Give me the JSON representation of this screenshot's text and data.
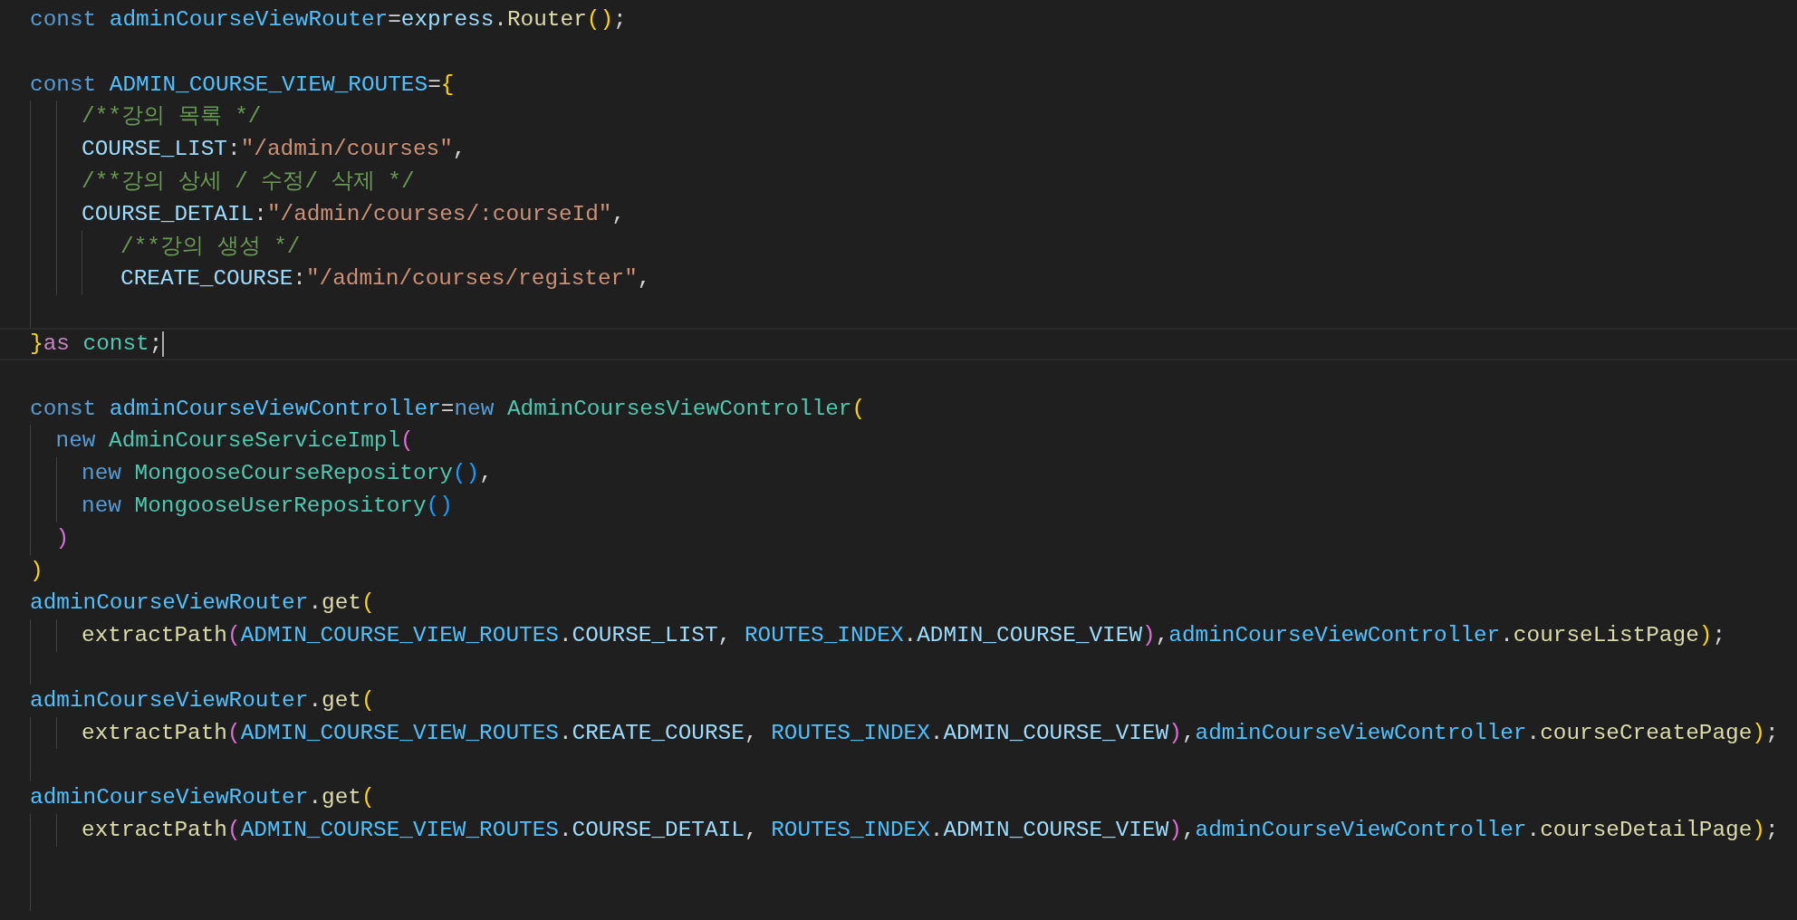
{
  "editor": {
    "lines": [
      {
        "kind": "code",
        "tokens": [
          {
            "kind": "kw",
            "text": "const "
          },
          {
            "kind": "var",
            "text": "adminCourseViewRouter"
          },
          {
            "kind": "plain",
            "text": "="
          },
          {
            "kind": "prop",
            "text": "express"
          },
          {
            "kind": "plain",
            "text": "."
          },
          {
            "kind": "fn",
            "text": "Router"
          },
          {
            "kind": "b1",
            "text": "()"
          },
          {
            "kind": "plain",
            "text": ";"
          }
        ]
      },
      {
        "kind": "blank"
      },
      {
        "kind": "code",
        "tokens": [
          {
            "kind": "kw",
            "text": "const "
          },
          {
            "kind": "var",
            "text": "ADMIN_COURSE_VIEW_ROUTES"
          },
          {
            "kind": "plain",
            "text": "="
          },
          {
            "kind": "b1",
            "text": "{"
          }
        ]
      },
      {
        "kind": "code",
        "indent": [
          {
            "kind": "guide"
          },
          {
            "kind": "guide"
          }
        ],
        "tokens": [
          {
            "kind": "comment",
            "text": "/**강의 목록 */"
          }
        ]
      },
      {
        "kind": "code",
        "indent": [
          {
            "kind": "guide"
          },
          {
            "kind": "guide"
          }
        ],
        "tokens": [
          {
            "kind": "prop",
            "text": "COURSE_LIST"
          },
          {
            "kind": "plain",
            "text": ":"
          },
          {
            "kind": "str",
            "text": "\"/admin/courses\""
          },
          {
            "kind": "plain",
            "text": ","
          }
        ]
      },
      {
        "kind": "code",
        "indent": [
          {
            "kind": "guide"
          },
          {
            "kind": "guide"
          }
        ],
        "tokens": [
          {
            "kind": "comment",
            "text": "/**강의 상세 / 수정/ 삭제 */"
          }
        ]
      },
      {
        "kind": "code",
        "indent": [
          {
            "kind": "guide"
          },
          {
            "kind": "guide"
          }
        ],
        "tokens": [
          {
            "kind": "prop",
            "text": "COURSE_DETAIL"
          },
          {
            "kind": "plain",
            "text": ":"
          },
          {
            "kind": "str",
            "text": "\"/admin/courses/:courseId\""
          },
          {
            "kind": "plain",
            "text": ","
          }
        ]
      },
      {
        "kind": "code",
        "indent": [
          {
            "kind": "guide"
          },
          {
            "kind": "guide"
          },
          {
            "kind": "wide"
          }
        ],
        "tokens": [
          {
            "kind": "comment",
            "text": "/**강의 생성 */"
          }
        ]
      },
      {
        "kind": "code",
        "indent": [
          {
            "kind": "guide"
          },
          {
            "kind": "guide"
          },
          {
            "kind": "wide"
          }
        ],
        "tokens": [
          {
            "kind": "prop",
            "text": "CREATE_COURSE"
          },
          {
            "kind": "plain",
            "text": ":"
          },
          {
            "kind": "str",
            "text": "\"/admin/courses/register\""
          },
          {
            "kind": "plain",
            "text": ","
          }
        ]
      },
      {
        "kind": "blank",
        "indent": [
          {
            "kind": "guide"
          }
        ]
      },
      {
        "kind": "code",
        "current": true,
        "tokens": [
          {
            "kind": "b1",
            "text": "}"
          },
          {
            "kind": "ctrl",
            "text": "as "
          },
          {
            "kind": "type",
            "text": "const"
          },
          {
            "kind": "plain",
            "text": ";"
          }
        ]
      },
      {
        "kind": "blank"
      },
      {
        "kind": "code",
        "tokens": [
          {
            "kind": "kw",
            "text": "const "
          },
          {
            "kind": "var",
            "text": "adminCourseViewController"
          },
          {
            "kind": "plain",
            "text": "="
          },
          {
            "kind": "kw",
            "text": "new "
          },
          {
            "kind": "type",
            "text": "AdminCoursesViewController"
          },
          {
            "kind": "b1",
            "text": "("
          }
        ]
      },
      {
        "kind": "code",
        "indent": [
          {
            "kind": "guide"
          }
        ],
        "tokens": [
          {
            "kind": "kw",
            "text": "new "
          },
          {
            "kind": "type",
            "text": "AdminCourseServiceImpl"
          },
          {
            "kind": "b2",
            "text": "("
          }
        ]
      },
      {
        "kind": "code",
        "indent": [
          {
            "kind": "guide"
          },
          {
            "kind": "guide"
          }
        ],
        "tokens": [
          {
            "kind": "kw",
            "text": "new "
          },
          {
            "kind": "type",
            "text": "MongooseCourseRepository"
          },
          {
            "kind": "b3",
            "text": "()"
          },
          {
            "kind": "plain",
            "text": ","
          }
        ]
      },
      {
        "kind": "code",
        "indent": [
          {
            "kind": "guide"
          },
          {
            "kind": "guide"
          }
        ],
        "tokens": [
          {
            "kind": "kw",
            "text": "new "
          },
          {
            "kind": "type",
            "text": "MongooseUserRepository"
          },
          {
            "kind": "b3",
            "text": "()"
          }
        ]
      },
      {
        "kind": "code",
        "indent": [
          {
            "kind": "guide"
          }
        ],
        "tokens": [
          {
            "kind": "b2",
            "text": ")"
          }
        ]
      },
      {
        "kind": "code",
        "tokens": [
          {
            "kind": "b1",
            "text": ")"
          }
        ]
      },
      {
        "kind": "code",
        "tokens": [
          {
            "kind": "var",
            "text": "adminCourseViewRouter"
          },
          {
            "kind": "plain",
            "text": "."
          },
          {
            "kind": "fn",
            "text": "get"
          },
          {
            "kind": "b1",
            "text": "("
          }
        ]
      },
      {
        "kind": "code",
        "indent": [
          {
            "kind": "guide"
          },
          {
            "kind": "guide"
          }
        ],
        "tokens": [
          {
            "kind": "fn",
            "text": "extractPath"
          },
          {
            "kind": "b2",
            "text": "("
          },
          {
            "kind": "var",
            "text": "ADMIN_COURSE_VIEW_ROUTES"
          },
          {
            "kind": "plain",
            "text": "."
          },
          {
            "kind": "prop",
            "text": "COURSE_LIST"
          },
          {
            "kind": "plain",
            "text": ", "
          },
          {
            "kind": "var",
            "text": "ROUTES_INDEX"
          },
          {
            "kind": "plain",
            "text": "."
          },
          {
            "kind": "prop",
            "text": "ADMIN_COURSE_VIEW"
          },
          {
            "kind": "b2",
            "text": ")"
          },
          {
            "kind": "plain",
            "text": ","
          },
          {
            "kind": "var",
            "text": "adminCourseViewController"
          },
          {
            "kind": "plain",
            "text": "."
          },
          {
            "kind": "fn",
            "text": "courseListPage"
          },
          {
            "kind": "b1",
            "text": ")"
          },
          {
            "kind": "plain",
            "text": ";"
          }
        ]
      },
      {
        "kind": "blank",
        "indent": [
          {
            "kind": "guide"
          }
        ]
      },
      {
        "kind": "code",
        "tokens": [
          {
            "kind": "var",
            "text": "adminCourseViewRouter"
          },
          {
            "kind": "plain",
            "text": "."
          },
          {
            "kind": "fn",
            "text": "get"
          },
          {
            "kind": "b1",
            "text": "("
          }
        ]
      },
      {
        "kind": "code",
        "indent": [
          {
            "kind": "guide"
          },
          {
            "kind": "guide"
          }
        ],
        "tokens": [
          {
            "kind": "fn",
            "text": "extractPath"
          },
          {
            "kind": "b2",
            "text": "("
          },
          {
            "kind": "var",
            "text": "ADMIN_COURSE_VIEW_ROUTES"
          },
          {
            "kind": "plain",
            "text": "."
          },
          {
            "kind": "prop",
            "text": "CREATE_COURSE"
          },
          {
            "kind": "plain",
            "text": ", "
          },
          {
            "kind": "var",
            "text": "ROUTES_INDEX"
          },
          {
            "kind": "plain",
            "text": "."
          },
          {
            "kind": "prop",
            "text": "ADMIN_COURSE_VIEW"
          },
          {
            "kind": "b2",
            "text": ")"
          },
          {
            "kind": "plain",
            "text": ","
          },
          {
            "kind": "var",
            "text": "adminCourseViewController"
          },
          {
            "kind": "plain",
            "text": "."
          },
          {
            "kind": "fn",
            "text": "courseCreatePage"
          },
          {
            "kind": "b1",
            "text": ")"
          },
          {
            "kind": "plain",
            "text": ";"
          }
        ]
      },
      {
        "kind": "blank",
        "indent": [
          {
            "kind": "guide"
          }
        ]
      },
      {
        "kind": "code",
        "tokens": [
          {
            "kind": "var",
            "text": "adminCourseViewRouter"
          },
          {
            "kind": "plain",
            "text": "."
          },
          {
            "kind": "fn",
            "text": "get"
          },
          {
            "kind": "b1",
            "text": "("
          }
        ]
      },
      {
        "kind": "code",
        "indent": [
          {
            "kind": "guide"
          },
          {
            "kind": "guide"
          }
        ],
        "tokens": [
          {
            "kind": "fn",
            "text": "extractPath"
          },
          {
            "kind": "b2",
            "text": "("
          },
          {
            "kind": "var",
            "text": "ADMIN_COURSE_VIEW_ROUTES"
          },
          {
            "kind": "plain",
            "text": "."
          },
          {
            "kind": "prop",
            "text": "COURSE_DETAIL"
          },
          {
            "kind": "plain",
            "text": ", "
          },
          {
            "kind": "var",
            "text": "ROUTES_INDEX"
          },
          {
            "kind": "plain",
            "text": "."
          },
          {
            "kind": "prop",
            "text": "ADMIN_COURSE_VIEW"
          },
          {
            "kind": "b2",
            "text": ")"
          },
          {
            "kind": "plain",
            "text": ","
          },
          {
            "kind": "var",
            "text": "adminCourseViewController"
          },
          {
            "kind": "plain",
            "text": "."
          },
          {
            "kind": "fn",
            "text": "courseDetailPage"
          },
          {
            "kind": "b1",
            "text": ")"
          },
          {
            "kind": "plain",
            "text": ";"
          }
        ]
      },
      {
        "kind": "blank",
        "indent": [
          {
            "kind": "guide"
          }
        ]
      },
      {
        "kind": "blank",
        "indent": [
          {
            "kind": "guide"
          }
        ]
      }
    ]
  }
}
